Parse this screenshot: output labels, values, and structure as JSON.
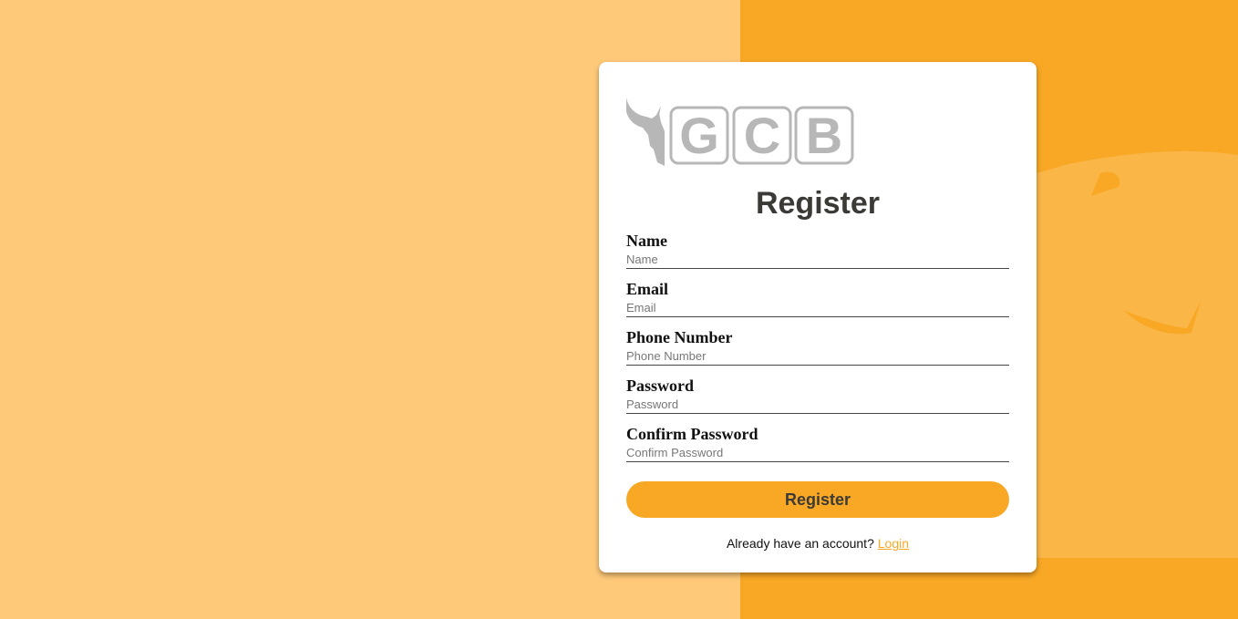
{
  "colors": {
    "background_left": "#fec979",
    "background_right": "#f8a825",
    "accent": "#f8a825",
    "title_text": "#3b3a36",
    "logo_gray": "#b7b7b7"
  },
  "logo": {
    "text": "GCB",
    "letters": [
      "G",
      "C",
      "B"
    ],
    "icon": "bull-head-icon"
  },
  "form": {
    "title": "Register",
    "fields": [
      {
        "label": "Name",
        "placeholder": "Name",
        "value": ""
      },
      {
        "label": "Email",
        "placeholder": "Email",
        "value": ""
      },
      {
        "label": "Phone Number",
        "placeholder": "Phone Number",
        "value": ""
      },
      {
        "label": "Password",
        "placeholder": "Password",
        "value": ""
      },
      {
        "label": "Confirm Password",
        "placeholder": "Confirm Password",
        "value": ""
      }
    ],
    "submit_label": "Register",
    "footer_text": "Already have an account? ",
    "login_link": "Login"
  }
}
